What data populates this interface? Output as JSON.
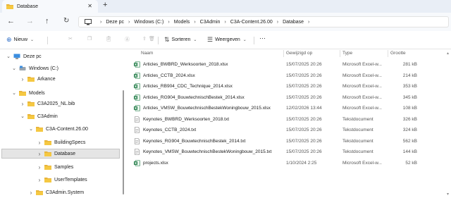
{
  "window": {
    "tab_title": "Database"
  },
  "address": {
    "crumbs": [
      "Deze pc",
      "Windows (C:)",
      "Models",
      "C3Admin",
      "C3A-Content.26.00",
      "Database"
    ]
  },
  "toolbar": {
    "new_label": "Nieuw",
    "sort_label": "Sorteren",
    "view_label": "Weergeven",
    "more_label": "···"
  },
  "nav": {
    "items": [
      {
        "label": "Deze pc",
        "icon": "pc-icon",
        "expanded": true
      },
      {
        "label": "Windows (C:)",
        "icon": "drive-icon",
        "expanded": true
      },
      {
        "label": "Arkance",
        "icon": "folder-icon",
        "expanded": false
      },
      {
        "label": "Models",
        "icon": "folder-icon",
        "expanded": true
      },
      {
        "label": "C3A2025_NL.bib",
        "icon": "folder-icon",
        "expanded": false
      },
      {
        "label": "C3Admin",
        "icon": "folder-icon",
        "expanded": true
      },
      {
        "label": "C3A-Content.26.00",
        "icon": "folder-icon",
        "expanded": true
      },
      {
        "label": "BuildingSpecs",
        "icon": "folder-icon",
        "expanded": false
      },
      {
        "label": "Database",
        "icon": "folder-icon",
        "expanded": false,
        "selected": true
      },
      {
        "label": "Samples",
        "icon": "folder-icon",
        "expanded": false
      },
      {
        "label": "UserTemplates",
        "icon": "folder-icon",
        "expanded": false
      },
      {
        "label": "C3Admin.System",
        "icon": "folder-icon",
        "expanded": false
      }
    ]
  },
  "columns": {
    "name": "Naam",
    "date": "Gewijzigd op",
    "type": "Type",
    "size": "Grootte"
  },
  "files": [
    {
      "name": "Articles_BWBRD_Werksoorten_2018.xlsx",
      "date": "15/07/2025 20:26",
      "type": "Microsoft Excel-w...",
      "size": "281 kB",
      "kind": "excel"
    },
    {
      "name": "Articles_CCTB_2024.xlsx",
      "date": "15/07/2025 20:26",
      "type": "Microsoft Excel-w...",
      "size": "214 kB",
      "kind": "excel"
    },
    {
      "name": "Articles_RB904_CDC_Technique_2014.xlsx",
      "date": "15/07/2025 20:26",
      "type": "Microsoft Excel-w...",
      "size": "353 kB",
      "kind": "excel"
    },
    {
      "name": "Articles_RG904_BouwtechnischBestek_2014.xlsx",
      "date": "15/07/2025 20:26",
      "type": "Microsoft Excel-w...",
      "size": "345 kB",
      "kind": "excel"
    },
    {
      "name": "Articles_VMSW_BouwtechnischBestekWoningbouw_2015.xlsx",
      "date": "12/02/2026 13:44",
      "type": "Microsoft Excel-w...",
      "size": "108 kB",
      "kind": "excel"
    },
    {
      "name": "Keynotes_BWBRD_Werksoorten_2018.txt",
      "date": "15/07/2025 20:26",
      "type": "Tekstdocument",
      "size": "326 kB",
      "kind": "text"
    },
    {
      "name": "Keynotes_CCTB_2024.txt",
      "date": "15/07/2025 20:26",
      "type": "Tekstdocument",
      "size": "324 kB",
      "kind": "text"
    },
    {
      "name": "Keynotes_RG904_BouwtechnischBestek_2014.txt",
      "date": "15/07/2025 20:26",
      "type": "Tekstdocument",
      "size": "562 kB",
      "kind": "text"
    },
    {
      "name": "Keynotes_VMSW_BouwtechnischBestekWoningbouw_2015.txt",
      "date": "15/07/2025 20:26",
      "type": "Tekstdocument",
      "size": "144 kB",
      "kind": "text"
    },
    {
      "name": "projects.xlsx",
      "date": "1/10/2024 2:25",
      "type": "Microsoft Excel-w...",
      "size": "52 kB",
      "kind": "excel"
    }
  ]
}
